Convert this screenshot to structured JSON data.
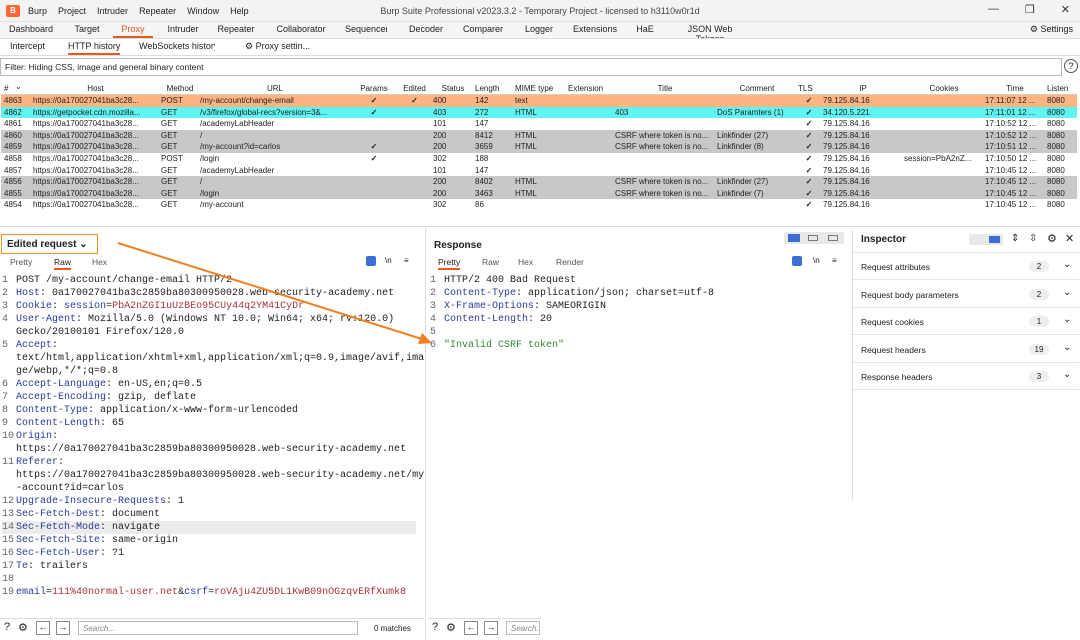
{
  "app": {
    "logo": "B",
    "title": "Burp Suite Professional v2023.3.2 - Temporary Project - licensed to h3110w0r1d",
    "menu": [
      "Burp",
      "Project",
      "Intruder",
      "Repeater",
      "Window",
      "Help"
    ],
    "controls": [
      "—",
      "❐",
      "✕"
    ]
  },
  "tabs": [
    "Dashboard",
    "Target",
    "Proxy",
    "Intruder",
    "Repeater",
    "Collaborator",
    "Sequencer",
    "Decoder",
    "Comparer",
    "Logger",
    "Extensions",
    "HaE",
    "JSON Web Tokens"
  ],
  "settings_label": "Settings",
  "subtabs": [
    "Intercept",
    "HTTP history",
    "WebSockets history",
    "Proxy settin..."
  ],
  "filter_text": "Filter: Hiding CSS, image and general binary content",
  "help": "?",
  "table": {
    "headers": [
      "#",
      "Host",
      "Method",
      "URL",
      "Params",
      "Edited",
      "Status",
      "Length",
      "MIME type",
      "Extension",
      "Title",
      "Comment",
      "TLS",
      "IP",
      "Cookies",
      "Time",
      "Listen"
    ],
    "sort_indicator": "⌄",
    "rows": [
      {
        "style": "orange",
        "c": [
          "4863",
          "https://0a170027041ba3c28...",
          "POST",
          "/my-account/change-email",
          "✓",
          "✓",
          "400",
          "142",
          "text",
          "",
          "",
          "",
          "✓",
          "79.125.84.16",
          "",
          "17:11:07 12 ...",
          "8080"
        ]
      },
      {
        "style": "cyan",
        "c": [
          "4862",
          "https://getpocket.cdn.mozilla...",
          "GET",
          "/v3/firefox/global-recs?version=3&...",
          "✓",
          "",
          "403",
          "272",
          "HTML",
          "",
          "403",
          "DoS Paramters (1)",
          "✓",
          "34.120.5.221",
          "",
          "17:11:01 12 ...",
          "8080"
        ]
      },
      {
        "style": "",
        "c": [
          "4861",
          "https://0a170027041ba3c28...",
          "GET",
          "/academyLabHeader",
          "",
          "",
          "101",
          "147",
          "",
          "",
          "",
          "",
          "✓",
          "79.125.84.16",
          "",
          "17:10:52 12 ...",
          "8080"
        ]
      },
      {
        "style": "gray",
        "c": [
          "4860",
          "https://0a170027041ba3c28...",
          "GET",
          "/",
          "",
          "",
          "200",
          "8412",
          "HTML",
          "",
          "CSRF where token is no...",
          "Linkfinder (27)",
          "✓",
          "79.125.84.16",
          "",
          "17:10:52 12 ...",
          "8080"
        ]
      },
      {
        "style": "gray",
        "c": [
          "4859",
          "https://0a170027041ba3c28...",
          "GET",
          "/my-account?id=carlos",
          "✓",
          "",
          "200",
          "3659",
          "HTML",
          "",
          "CSRF where token is no...",
          "Linkfinder (8)",
          "✓",
          "79.125.84.16",
          "",
          "17:10:51 12 ...",
          "8080"
        ]
      },
      {
        "style": "",
        "c": [
          "4858",
          "https://0a170027041ba3c28...",
          "POST",
          "/login",
          "✓",
          "",
          "302",
          "188",
          "",
          "",
          "",
          "",
          "✓",
          "79.125.84.16",
          "session=PbA2nZ...",
          "17:10:50 12 ...",
          "8080"
        ]
      },
      {
        "style": "",
        "c": [
          "4857",
          "https://0a170027041ba3c28...",
          "GET",
          "/academyLabHeader",
          "",
          "",
          "101",
          "147",
          "",
          "",
          "",
          "",
          "✓",
          "79.125.84.16",
          "",
          "17:10:45 12 ...",
          "8080"
        ]
      },
      {
        "style": "gray",
        "c": [
          "4856",
          "https://0a170027041ba3c28...",
          "GET",
          "/",
          "",
          "",
          "200",
          "8402",
          "HTML",
          "",
          "CSRF where token is no...",
          "Linkfinder (27)",
          "✓",
          "79.125.84.16",
          "",
          "17:10:45 12 ...",
          "8080"
        ]
      },
      {
        "style": "gray",
        "c": [
          "4855",
          "https://0a170027041ba3c28...",
          "GET",
          "/login",
          "",
          "",
          "200",
          "3463",
          "HTML",
          "",
          "CSRF where token is no...",
          "Linkfinder (7)",
          "✓",
          "79.125.84.16",
          "",
          "17:10:45 12 ...",
          "8080"
        ]
      },
      {
        "style": "",
        "c": [
          "4854",
          "https://0a170027041ba3c28...",
          "GET",
          "/my-account",
          "",
          "",
          "302",
          "86",
          "",
          "",
          "",
          "",
          "✓",
          "79.125.84.16",
          "",
          "17:10:45 12 ...",
          "8080"
        ]
      }
    ]
  },
  "request": {
    "title": "Edited request",
    "dropdown": "⌄",
    "tabs": [
      "Pretty",
      "Raw",
      "Hex"
    ],
    "active_tab": "Raw",
    "newline_toggle": "\\n",
    "menu": "≡",
    "lines": [
      {
        "n": "1",
        "parts": [
          {
            "t": "v",
            "s": "POST /my-account/change-email HTTP/2"
          }
        ]
      },
      {
        "n": "2",
        "parts": [
          {
            "t": "k",
            "s": "Host"
          },
          {
            "t": "v",
            "s": ": 0a170027041ba3c2859ba80300950028.web-security-academy.net"
          }
        ]
      },
      {
        "n": "3",
        "parts": [
          {
            "t": "k",
            "s": "Cookie"
          },
          {
            "t": "v",
            "s": ": "
          },
          {
            "t": "k",
            "s": "session"
          },
          {
            "t": "v",
            "s": "="
          },
          {
            "t": "p",
            "s": "PbA2nZGI1uUzBEo95CUy44q2YM41CyDr"
          }
        ]
      },
      {
        "n": "4",
        "parts": [
          {
            "t": "k",
            "s": "User-Agent"
          },
          {
            "t": "v",
            "s": ": Mozilla/5.0 (Windows NT 10.0; Win64; x64; rv:120.0)"
          }
        ]
      },
      {
        "n": "",
        "parts": [
          {
            "t": "v",
            "s": "Gecko/20100101 Firefox/120.0"
          }
        ]
      },
      {
        "n": "5",
        "parts": [
          {
            "t": "k",
            "s": "Accept"
          },
          {
            "t": "v",
            "s": ":"
          }
        ]
      },
      {
        "n": "",
        "parts": [
          {
            "t": "v",
            "s": "text/html,application/xhtml+xml,application/xml;q=0.9,image/avif,ima"
          }
        ]
      },
      {
        "n": "",
        "parts": [
          {
            "t": "v",
            "s": "ge/webp,*/*;q=0.8"
          }
        ]
      },
      {
        "n": "6",
        "parts": [
          {
            "t": "k",
            "s": "Accept-Language"
          },
          {
            "t": "v",
            "s": ": en-US,en;q=0.5"
          }
        ]
      },
      {
        "n": "7",
        "parts": [
          {
            "t": "k",
            "s": "Accept-Encoding"
          },
          {
            "t": "v",
            "s": ": gzip, deflate"
          }
        ]
      },
      {
        "n": "8",
        "parts": [
          {
            "t": "k",
            "s": "Content-Type"
          },
          {
            "t": "v",
            "s": ": application/x-www-form-urlencoded"
          }
        ]
      },
      {
        "n": "9",
        "parts": [
          {
            "t": "k",
            "s": "Content-Length"
          },
          {
            "t": "v",
            "s": ": 65"
          }
        ]
      },
      {
        "n": "10",
        "parts": [
          {
            "t": "k",
            "s": "Origin"
          },
          {
            "t": "v",
            "s": ":"
          }
        ]
      },
      {
        "n": "",
        "parts": [
          {
            "t": "v",
            "s": "https://0a170027041ba3c2859ba80300950028.web-security-academy.net"
          }
        ]
      },
      {
        "n": "11",
        "parts": [
          {
            "t": "k",
            "s": "Referer"
          },
          {
            "t": "v",
            "s": ":"
          }
        ]
      },
      {
        "n": "",
        "parts": [
          {
            "t": "v",
            "s": "https://0a170027041ba3c2859ba80300950028.web-security-academy.net/my"
          }
        ]
      },
      {
        "n": "",
        "parts": [
          {
            "t": "v",
            "s": "-account?id=carlos"
          }
        ]
      },
      {
        "n": "12",
        "parts": [
          {
            "t": "k",
            "s": "Upgrade-Insecure-Requests"
          },
          {
            "t": "v",
            "s": ": 1"
          }
        ]
      },
      {
        "n": "13",
        "parts": [
          {
            "t": "k",
            "s": "Sec-Fetch-Dest"
          },
          {
            "t": "v",
            "s": ": document"
          }
        ]
      },
      {
        "n": "14",
        "hl": true,
        "parts": [
          {
            "t": "k",
            "s": "Sec-Fetch-Mode"
          },
          {
            "t": "v",
            "s": ": navigate"
          }
        ]
      },
      {
        "n": "15",
        "parts": [
          {
            "t": "k",
            "s": "Sec-Fetch-Site"
          },
          {
            "t": "v",
            "s": ": same-origin"
          }
        ]
      },
      {
        "n": "16",
        "parts": [
          {
            "t": "k",
            "s": "Sec-Fetch-User"
          },
          {
            "t": "v",
            "s": ": ?1"
          }
        ]
      },
      {
        "n": "17",
        "parts": [
          {
            "t": "k",
            "s": "Te"
          },
          {
            "t": "v",
            "s": ": trailers"
          }
        ]
      },
      {
        "n": "18",
        "parts": [
          {
            "t": "v",
            "s": ""
          }
        ]
      },
      {
        "n": "19",
        "parts": [
          {
            "t": "k",
            "s": "email"
          },
          {
            "t": "v",
            "s": "="
          },
          {
            "t": "p",
            "s": "111%40normal-user.net"
          },
          {
            "t": "v",
            "s": "&"
          },
          {
            "t": "k",
            "s": "csrf"
          },
          {
            "t": "v",
            "s": "="
          },
          {
            "t": "p",
            "s": "roVAju4ZU5DL1KwB09nOGzqvERfXumk8"
          }
        ]
      }
    ],
    "search_placeholder": "Search...",
    "matches": "0 matches"
  },
  "response": {
    "title": "Response",
    "tabs": [
      "Pretty",
      "Raw",
      "Hex",
      "Render"
    ],
    "active_tab": "Pretty",
    "lines": [
      {
        "n": "1",
        "parts": [
          {
            "t": "v",
            "s": "HTTP/2 400 Bad Request"
          }
        ]
      },
      {
        "n": "2",
        "parts": [
          {
            "t": "k",
            "s": "Content-Type"
          },
          {
            "t": "v",
            "s": ": application/json; charset=utf-8"
          }
        ]
      },
      {
        "n": "3",
        "parts": [
          {
            "t": "k",
            "s": "X-Frame-Options"
          },
          {
            "t": "v",
            "s": ": SAMEORIGIN"
          }
        ]
      },
      {
        "n": "4",
        "parts": [
          {
            "t": "k",
            "s": "Content-Length"
          },
          {
            "t": "v",
            "s": ": 20"
          }
        ]
      },
      {
        "n": "5",
        "parts": [
          {
            "t": "v",
            "s": ""
          }
        ]
      },
      {
        "n": "6",
        "parts": [
          {
            "t": "q",
            "s": "\"Invalid CSRF token\""
          }
        ]
      }
    ],
    "search_placeholder": "Search..."
  },
  "inspector": {
    "title": "Inspector",
    "items": [
      {
        "label": "Request attributes",
        "count": "2"
      },
      {
        "label": "Request body parameters",
        "count": "2"
      },
      {
        "label": "Request cookies",
        "count": "1"
      },
      {
        "label": "Request headers",
        "count": "19"
      },
      {
        "label": "Response headers",
        "count": "3"
      }
    ]
  },
  "colors": {
    "accent": "#e8581c",
    "orange_row": "#ffb482",
    "cyan_row": "#5ff5f5",
    "gray_row": "#c8c8c8"
  }
}
